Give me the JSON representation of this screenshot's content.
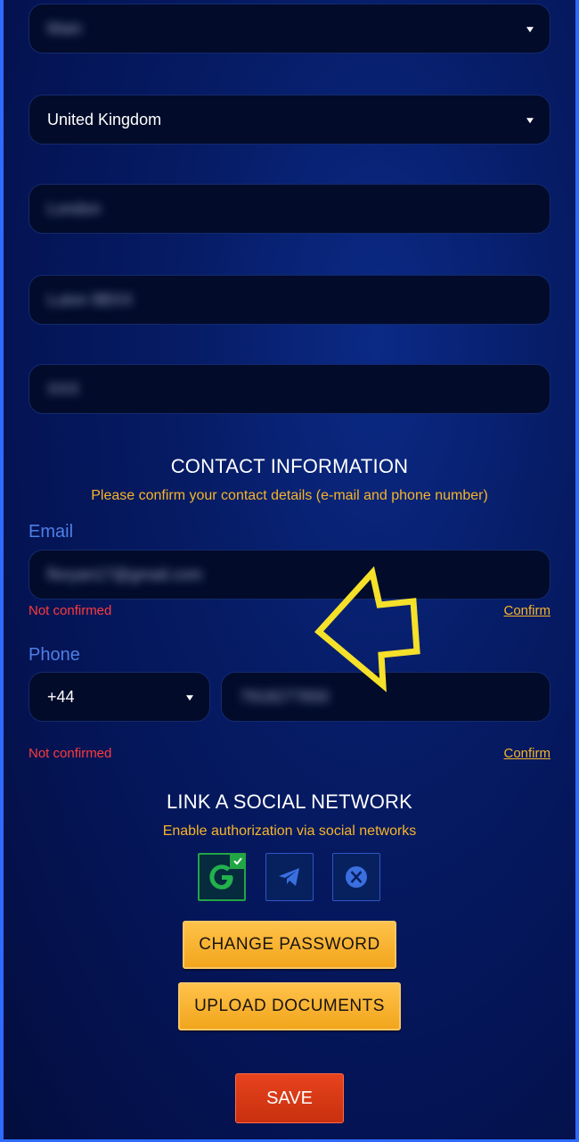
{
  "address": {
    "region_value": "Main",
    "country_value": "United Kingdom",
    "city_value": "London",
    "postcode_value": "Luton 9BXX",
    "street_value": "XXX"
  },
  "contact": {
    "title": "CONTACT INFORMATION",
    "subtitle": "Please confirm your contact details (e-mail and phone number)",
    "email_label": "Email",
    "email_value": "floryan17@gmail.com",
    "email_status": "Not confirmed",
    "email_confirm_label": "Confirm",
    "phone_label": "Phone",
    "phone_code": "+44",
    "phone_value": "7918277650",
    "phone_status": "Not confirmed",
    "phone_confirm_label": "Confirm"
  },
  "social": {
    "title": "LINK A SOCIAL NETWORK",
    "subtitle": "Enable authorization via social networks",
    "networks": [
      {
        "icon": "google-icon",
        "linked": true
      },
      {
        "icon": "telegram-icon",
        "linked": false
      },
      {
        "icon": "x-icon",
        "linked": false
      }
    ]
  },
  "actions": {
    "change_password_label": "CHANGE PASSWORD",
    "upload_documents_label": "UPLOAD DOCUMENTS",
    "save_label": "SAVE"
  },
  "colors": {
    "accent_gold": "#f7b529",
    "error_red": "#ff3b3b",
    "label_blue": "#4f7fe8",
    "save_red": "#d9381a"
  }
}
